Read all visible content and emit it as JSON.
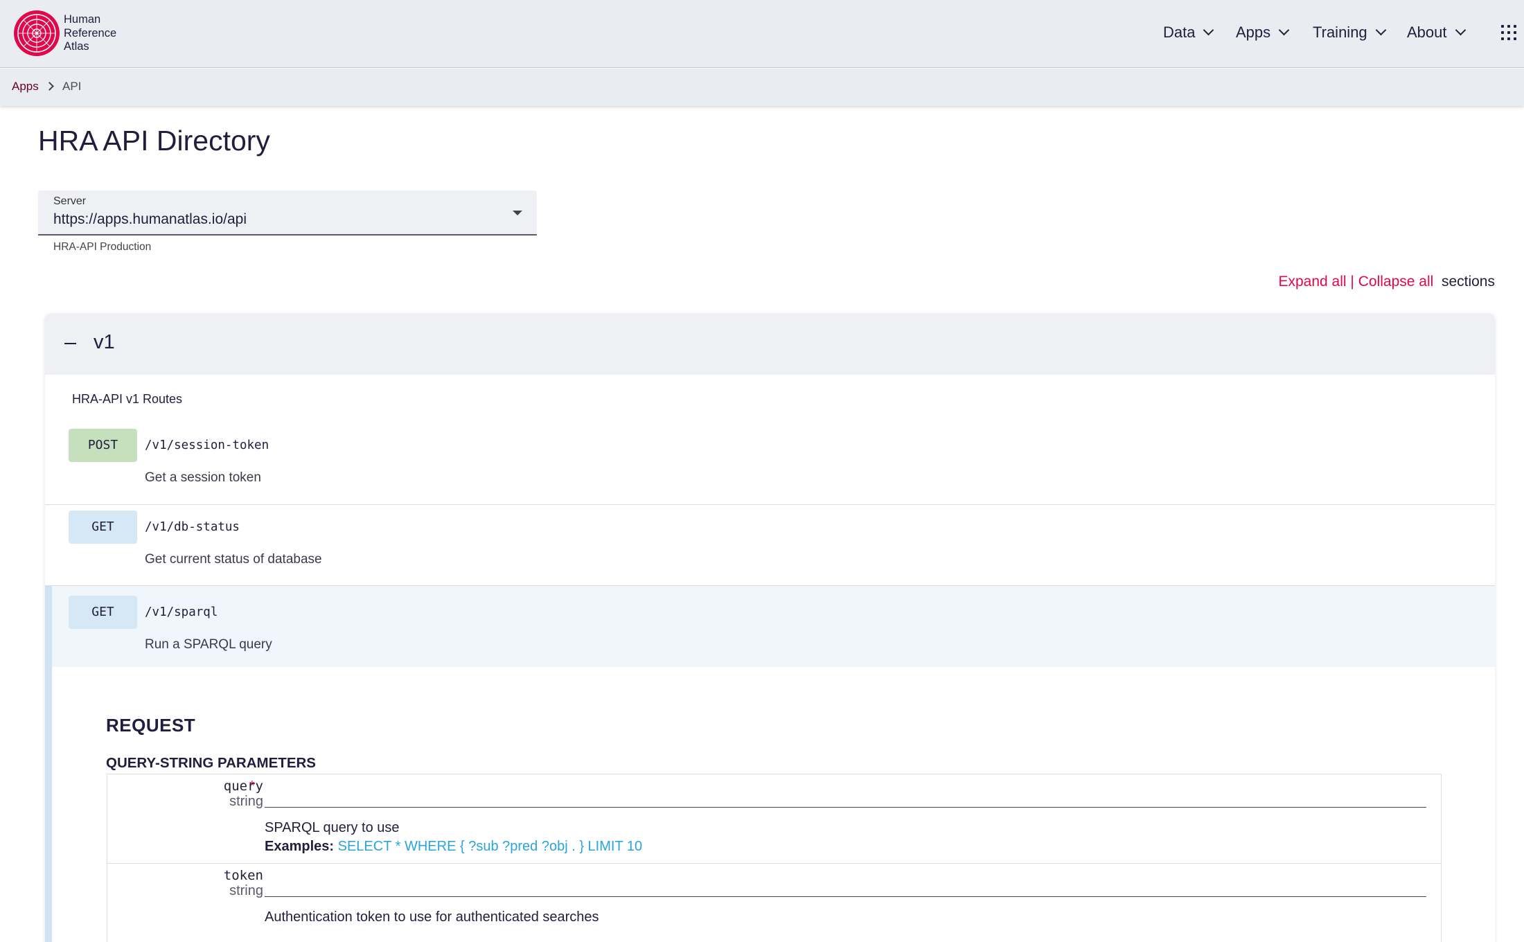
{
  "brand": {
    "line1": "Human",
    "line2": "Reference",
    "line3": "Atlas",
    "color": "#e0074a"
  },
  "nav": {
    "items": [
      "Data",
      "Apps",
      "Training",
      "About"
    ]
  },
  "breadcrumb": {
    "parent": "Apps",
    "current": "API"
  },
  "page": {
    "title": "HRA API Directory"
  },
  "server": {
    "label": "Server",
    "value": "https://apps.humanatlas.io/api",
    "hint": "HRA-API Production"
  },
  "toggles": {
    "expand_all": "Expand all",
    "separator": "|",
    "collapse_all": "Collapse all",
    "suffix": "sections"
  },
  "section": {
    "title": "v1",
    "description": "HRA-API v1 Routes",
    "routes": [
      {
        "method": "POST",
        "path": "/v1/session-token",
        "summary": "Get a session token"
      },
      {
        "method": "GET",
        "path": "/v1/db-status",
        "summary": "Get current status of database"
      },
      {
        "method": "GET",
        "path": "/v1/sparql",
        "summary": "Run a SPARQL query"
      }
    ]
  },
  "request": {
    "title": "REQUEST",
    "query_title": "QUERY-STRING PARAMETERS",
    "params": [
      {
        "required_mark": "*",
        "name": "query",
        "type": "string",
        "description": "SPARQL query to use",
        "examples_label": "Examples:",
        "example": "SELECT * WHERE { ?sub ?pred ?obj . } LIMIT 10"
      },
      {
        "name": "token",
        "type": "string",
        "description": "Authentication token to use for authenticated searches"
      }
    ]
  }
}
